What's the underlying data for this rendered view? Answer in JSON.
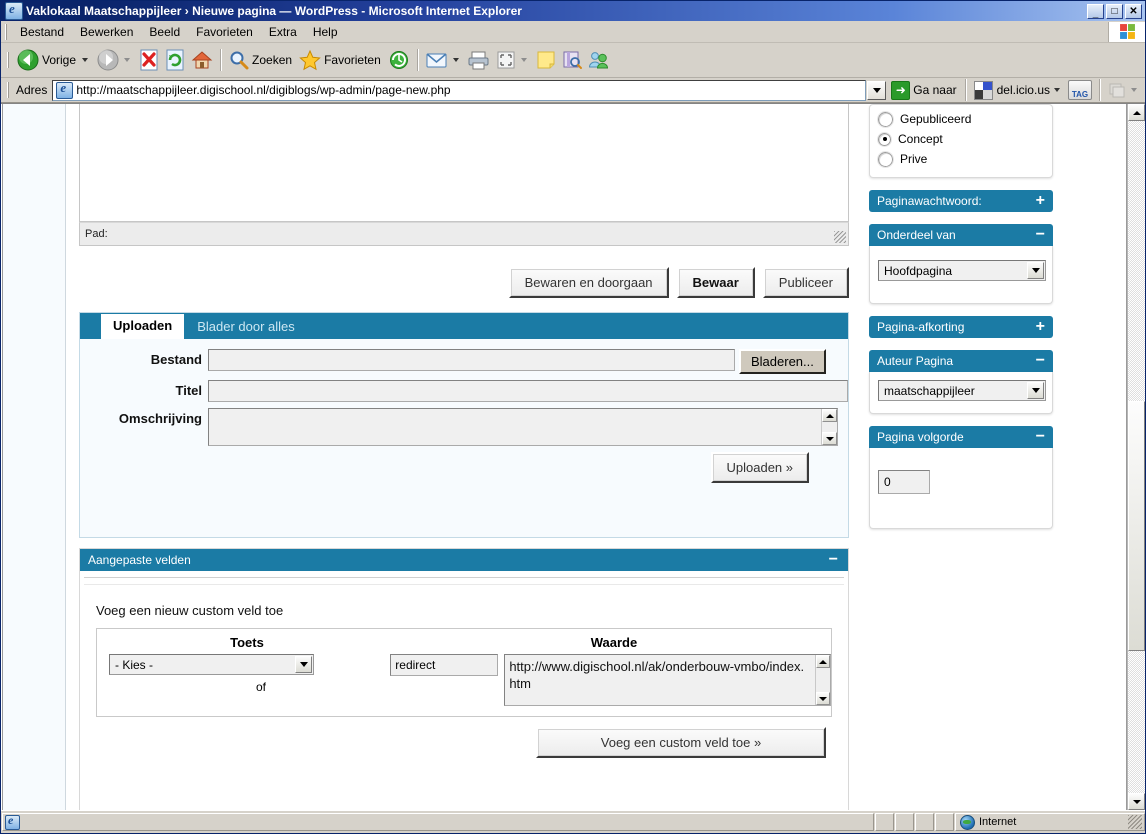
{
  "window": {
    "title": "Vaklokaal Maatschappijleer › Nieuwe pagina — WordPress - Microsoft Internet Explorer",
    "minimize": "_",
    "maximize": "□",
    "close": "✕"
  },
  "menu": {
    "items": [
      "Bestand",
      "Bewerken",
      "Beeld",
      "Favorieten",
      "Extra",
      "Help"
    ]
  },
  "toolbar": {
    "back_label": "Vorige",
    "search_label": "Zoeken",
    "favorites_label": "Favorieten",
    "icons": [
      "back-icon",
      "forward-icon",
      "stop-icon",
      "refresh-icon",
      "home-icon",
      "search-icon",
      "favorites-icon",
      "history-icon",
      "mail-icon",
      "print-icon",
      "edit-icon",
      "note-icon",
      "research-icon",
      "messenger-icon"
    ]
  },
  "address": {
    "label": "Adres",
    "url": "http://maatschappijleer.digischool.nl/digiblogs/wp-admin/page-new.php",
    "go_label": "Ga naar",
    "delicious_label": "del.icio.us",
    "tag_label": "TAG"
  },
  "editor": {
    "path_label": "Pad:"
  },
  "actions": {
    "save_continue": "Bewaren en doorgaan",
    "save": "Bewaar",
    "publish": "Publiceer"
  },
  "uploads": {
    "tab_upload": "Uploaden",
    "tab_browse": "Blader door alles",
    "file_label": "Bestand",
    "file_value": "",
    "browse_button": "Bladeren...",
    "title_label": "Titel",
    "title_value": "",
    "description_label": "Omschrijving",
    "description_value": "",
    "upload_button": "Uploaden »"
  },
  "custom_fields": {
    "panel_title": "Aangepaste velden",
    "collapse_icon": "−",
    "intro": "Voeg een nieuw custom veld toe",
    "col_key": "Toets",
    "col_value": "Waarde",
    "select_value": "- Kies -",
    "or_label": "of",
    "key_value": "redirect",
    "value_value": "http://www.digischool.nl/ak/onderbouw-vmbo/index.htm",
    "add_button": "Voeg een custom veld toe »"
  },
  "sidebar": {
    "status": {
      "options": [
        {
          "label": "Gepubliceerd",
          "selected": false
        },
        {
          "label": "Concept",
          "selected": true
        },
        {
          "label": "Prive",
          "selected": false
        }
      ]
    },
    "boxes": [
      {
        "title": "Paginawachtwoord:",
        "toggle": "+",
        "collapsed": true
      },
      {
        "title": "Onderdeel van",
        "toggle": "−",
        "collapsed": false,
        "select_value": "Hoofdpagina"
      },
      {
        "title": "Pagina-afkorting",
        "toggle": "+",
        "collapsed": true
      },
      {
        "title": "Auteur Pagina",
        "toggle": "−",
        "collapsed": false,
        "select_value": "maatschappijleer"
      },
      {
        "title": "Pagina volgorde",
        "toggle": "−",
        "collapsed": false,
        "input_value": "0"
      }
    ]
  },
  "statusbar": {
    "text": "",
    "zone": "Internet"
  },
  "colors": {
    "wp_blue": "#1b7ba5",
    "title_blue": "#0a246a",
    "chrome": "#d6d2ca",
    "panel_bg": "#f7fbfe"
  }
}
